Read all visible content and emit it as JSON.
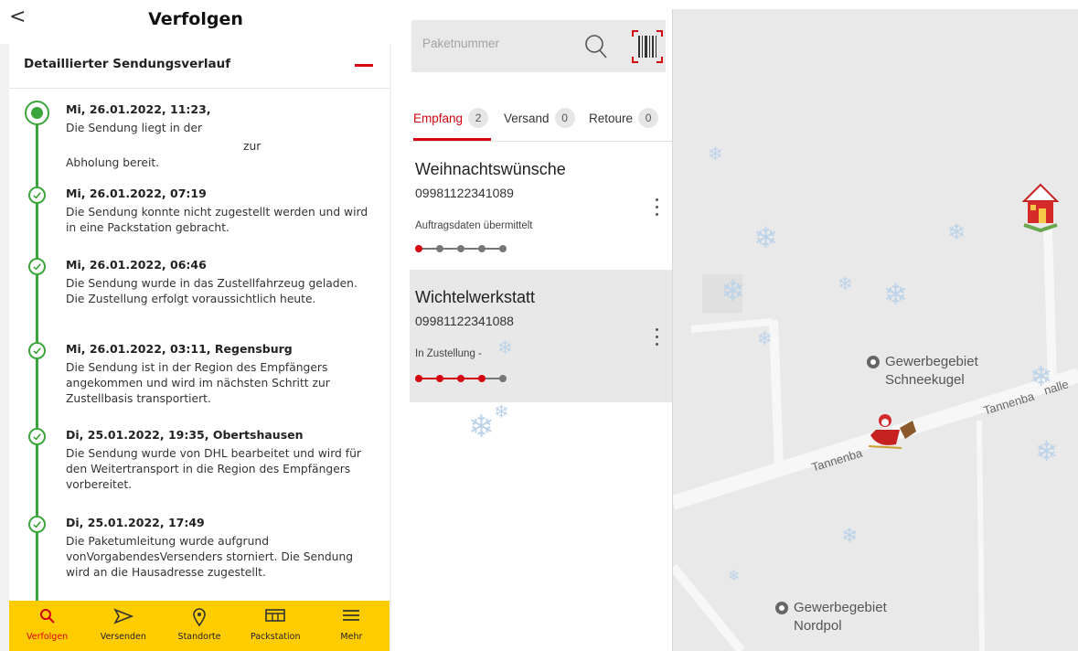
{
  "left": {
    "back_glyph": "<",
    "title": "Verfolgen",
    "section_title": "Detaillierter Sendungsverlauf",
    "events": [
      {
        "when": "Mi, 26.01.2022, 11:23,",
        "desc1": "Die Sendung liegt in der",
        "desc2": "zur",
        "desc3": "Abholung bereit."
      },
      {
        "when": "Mi, 26.01.2022, 07:19",
        "desc": "Die Sendung konnte nicht zugestellt werden und wird in eine Packstation gebracht."
      },
      {
        "when": "Mi, 26.01.2022, 06:46",
        "desc": "Die Sendung wurde in das Zustellfahrzeug geladen. Die Zustellung erfolgt voraussichtlich heute."
      },
      {
        "when": "Mi, 26.01.2022, 03:11, Regensburg",
        "desc": "Die Sendung ist in der Region des Empfängers angekommen und wird im nächsten Schritt zur Zustellbasis transportiert."
      },
      {
        "when": "Di, 25.01.2022, 19:35, Obertshausen",
        "desc": "Die Sendung wurde von DHL bearbeitet und wird für den Weitertransport in die Region des Empfängers vorbereitet."
      },
      {
        "when": "Di, 25.01.2022, 17:49",
        "desc": "Die Paketumleitung wurde aufgrund vonVorgabendesVersenders storniert. Die Sendung wird an die Hausadresse zugestellt."
      }
    ],
    "tabbar": [
      {
        "label": "Verfolgen",
        "icon": "search-icon",
        "active": true
      },
      {
        "label": "Versenden",
        "icon": "send-icon"
      },
      {
        "label": "Standorte",
        "icon": "location-pin-icon"
      },
      {
        "label": "Packstation",
        "icon": "packstation-icon"
      },
      {
        "label": "Mehr",
        "icon": "menu-icon"
      }
    ],
    "colors": {
      "dhl_yellow": "#ffcc00",
      "dhl_red": "#d40511",
      "timeline_green": "#3ca53c"
    }
  },
  "middle": {
    "search_placeholder": "Paketnummer",
    "tabs": [
      {
        "label": "Empfang",
        "count": "2"
      },
      {
        "label": "Versand",
        "count": "0"
      },
      {
        "label": "Retoure",
        "count": "0"
      }
    ],
    "shipments": [
      {
        "name": "Weihnachtswünsche",
        "number": "09981122341089",
        "status": "Auftragsdaten übermittelt",
        "progress_steps": 5,
        "progress_done": 1
      },
      {
        "name": "Wichtelwerkstatt",
        "number": "09981122341088",
        "status": "In Zustellung -",
        "progress_steps": 5,
        "progress_done": 4
      }
    ]
  },
  "map": {
    "pois": [
      {
        "line1": "Gewerbegebiet",
        "line2": "Schneekugel"
      },
      {
        "line1": "Gewerbegebiet",
        "line2": "Nordpol"
      }
    ],
    "streets": [
      "Tannenba",
      "Tannenba",
      "nalle"
    ]
  }
}
